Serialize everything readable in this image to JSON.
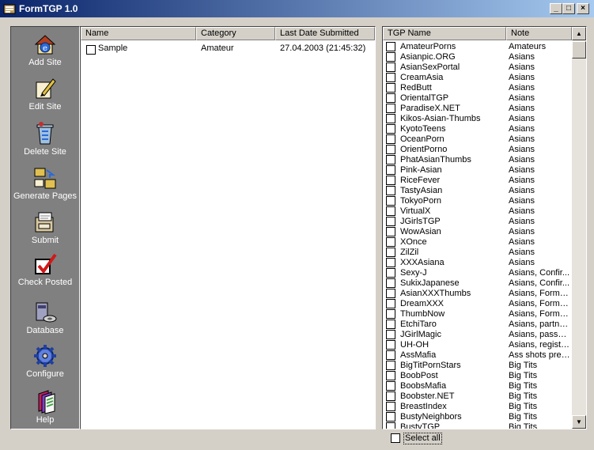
{
  "window": {
    "title": "FormTGP 1.0"
  },
  "sidebar": {
    "items": [
      {
        "label": "Add Site"
      },
      {
        "label": "Edit Site"
      },
      {
        "label": "Delete Site"
      },
      {
        "label": "Generate Pages"
      },
      {
        "label": "Submit"
      },
      {
        "label": "Check Posted"
      },
      {
        "label": "Database"
      },
      {
        "label": "Configure"
      },
      {
        "label": "Help"
      }
    ]
  },
  "sites": {
    "columns": [
      "Name",
      "Category",
      "Last Date Submitted"
    ],
    "rows": [
      {
        "name": "Sample",
        "category": "Amateur",
        "date": "27.04.2003 (21:45:32)"
      }
    ]
  },
  "tgp": {
    "columns": [
      "TGP Name",
      "Note"
    ],
    "rows": [
      {
        "name": "AmateurPorns",
        "note": "Amateurs"
      },
      {
        "name": "Asianpic.ORG",
        "note": "Asians"
      },
      {
        "name": "AsianSexPortal",
        "note": "Asians"
      },
      {
        "name": "CreamAsia",
        "note": "Asians"
      },
      {
        "name": "RedButt",
        "note": "Asians"
      },
      {
        "name": "OrientalTGP",
        "note": "Asians"
      },
      {
        "name": "ParadiseX.NET",
        "note": "Asians"
      },
      {
        "name": "Kikos-Asian-Thumbs",
        "note": "Asians"
      },
      {
        "name": "KyotoTeens",
        "note": "Asians"
      },
      {
        "name": "OceanPorn",
        "note": "Asians"
      },
      {
        "name": "OrientPorno",
        "note": "Asians"
      },
      {
        "name": "PhatAsianThumbs",
        "note": "Asians"
      },
      {
        "name": "Pink-Asian",
        "note": "Asians"
      },
      {
        "name": "RiceFever",
        "note": "Asians"
      },
      {
        "name": "TastyAsian",
        "note": "Asians"
      },
      {
        "name": "TokyoPorn",
        "note": "Asians"
      },
      {
        "name": "VirtualX",
        "note": "Asians"
      },
      {
        "name": "JGirlsTGP",
        "note": "Asians"
      },
      {
        "name": "WowAsian",
        "note": "Asians"
      },
      {
        "name": "XOnce",
        "note": "Asians"
      },
      {
        "name": "ZilZil",
        "note": "Asians"
      },
      {
        "name": "XXXAsiana",
        "note": "Asians"
      },
      {
        "name": "Sexy-J",
        "note": "Asians, Confir..."
      },
      {
        "name": "SukixJapanese",
        "note": "Asians, Confir..."
      },
      {
        "name": "AsianXXXThumbs",
        "note": "Asians, FormT..."
      },
      {
        "name": "DreamXXX",
        "note": "Asians, FormT..."
      },
      {
        "name": "ThumbNow",
        "note": "Asians, FormT..."
      },
      {
        "name": "EtchiTaro",
        "note": "Asians, partne..."
      },
      {
        "name": "JGirlMagic",
        "note": "Asians, passw..."
      },
      {
        "name": "UH-OH",
        "note": "Asians, registe..."
      },
      {
        "name": "AssMafia",
        "note": "Ass shots pref..."
      },
      {
        "name": "BigTitPornStars",
        "note": "Big Tits"
      },
      {
        "name": "BoobPost",
        "note": "Big Tits"
      },
      {
        "name": "BoobsMafia",
        "note": "Big Tits"
      },
      {
        "name": "Boobster.NET",
        "note": "Big Tits"
      },
      {
        "name": "BreastIndex",
        "note": "Big Tits"
      },
      {
        "name": "BustyNeighbors",
        "note": "Big Tits"
      },
      {
        "name": "BustyTGP",
        "note": "Big Tits"
      }
    ]
  },
  "footer": {
    "select_all": "Select all"
  }
}
